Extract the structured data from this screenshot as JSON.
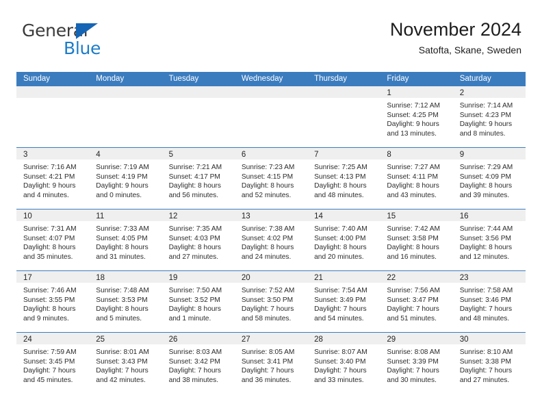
{
  "brand": {
    "name_top": "General",
    "name_bottom": "Blue",
    "accent_color": "#1d7cc9",
    "triangle_color": "#1565b4"
  },
  "header": {
    "title": "November 2024",
    "subtitle": "Satofta, Skane, Sweden",
    "header_bg": "#3b7cbf",
    "day_band_bg": "#efefef"
  },
  "weekdays": [
    "Sunday",
    "Monday",
    "Tuesday",
    "Wednesday",
    "Thursday",
    "Friday",
    "Saturday"
  ],
  "weeks": [
    [
      {
        "day": "",
        "empty": true,
        "sunrise": "",
        "sunset": "",
        "daylight_1": "",
        "daylight_2": ""
      },
      {
        "day": "",
        "empty": true,
        "sunrise": "",
        "sunset": "",
        "daylight_1": "",
        "daylight_2": ""
      },
      {
        "day": "",
        "empty": true,
        "sunrise": "",
        "sunset": "",
        "daylight_1": "",
        "daylight_2": ""
      },
      {
        "day": "",
        "empty": true,
        "sunrise": "",
        "sunset": "",
        "daylight_1": "",
        "daylight_2": ""
      },
      {
        "day": "",
        "empty": true,
        "sunrise": "",
        "sunset": "",
        "daylight_1": "",
        "daylight_2": ""
      },
      {
        "day": "1",
        "empty": false,
        "sunrise": "Sunrise: 7:12 AM",
        "sunset": "Sunset: 4:25 PM",
        "daylight_1": "Daylight: 9 hours",
        "daylight_2": "and 13 minutes."
      },
      {
        "day": "2",
        "empty": false,
        "sunrise": "Sunrise: 7:14 AM",
        "sunset": "Sunset: 4:23 PM",
        "daylight_1": "Daylight: 9 hours",
        "daylight_2": "and 8 minutes."
      }
    ],
    [
      {
        "day": "3",
        "empty": false,
        "sunrise": "Sunrise: 7:16 AM",
        "sunset": "Sunset: 4:21 PM",
        "daylight_1": "Daylight: 9 hours",
        "daylight_2": "and 4 minutes."
      },
      {
        "day": "4",
        "empty": false,
        "sunrise": "Sunrise: 7:19 AM",
        "sunset": "Sunset: 4:19 PM",
        "daylight_1": "Daylight: 9 hours",
        "daylight_2": "and 0 minutes."
      },
      {
        "day": "5",
        "empty": false,
        "sunrise": "Sunrise: 7:21 AM",
        "sunset": "Sunset: 4:17 PM",
        "daylight_1": "Daylight: 8 hours",
        "daylight_2": "and 56 minutes."
      },
      {
        "day": "6",
        "empty": false,
        "sunrise": "Sunrise: 7:23 AM",
        "sunset": "Sunset: 4:15 PM",
        "daylight_1": "Daylight: 8 hours",
        "daylight_2": "and 52 minutes."
      },
      {
        "day": "7",
        "empty": false,
        "sunrise": "Sunrise: 7:25 AM",
        "sunset": "Sunset: 4:13 PM",
        "daylight_1": "Daylight: 8 hours",
        "daylight_2": "and 48 minutes."
      },
      {
        "day": "8",
        "empty": false,
        "sunrise": "Sunrise: 7:27 AM",
        "sunset": "Sunset: 4:11 PM",
        "daylight_1": "Daylight: 8 hours",
        "daylight_2": "and 43 minutes."
      },
      {
        "day": "9",
        "empty": false,
        "sunrise": "Sunrise: 7:29 AM",
        "sunset": "Sunset: 4:09 PM",
        "daylight_1": "Daylight: 8 hours",
        "daylight_2": "and 39 minutes."
      }
    ],
    [
      {
        "day": "10",
        "empty": false,
        "sunrise": "Sunrise: 7:31 AM",
        "sunset": "Sunset: 4:07 PM",
        "daylight_1": "Daylight: 8 hours",
        "daylight_2": "and 35 minutes."
      },
      {
        "day": "11",
        "empty": false,
        "sunrise": "Sunrise: 7:33 AM",
        "sunset": "Sunset: 4:05 PM",
        "daylight_1": "Daylight: 8 hours",
        "daylight_2": "and 31 minutes."
      },
      {
        "day": "12",
        "empty": false,
        "sunrise": "Sunrise: 7:35 AM",
        "sunset": "Sunset: 4:03 PM",
        "daylight_1": "Daylight: 8 hours",
        "daylight_2": "and 27 minutes."
      },
      {
        "day": "13",
        "empty": false,
        "sunrise": "Sunrise: 7:38 AM",
        "sunset": "Sunset: 4:02 PM",
        "daylight_1": "Daylight: 8 hours",
        "daylight_2": "and 24 minutes."
      },
      {
        "day": "14",
        "empty": false,
        "sunrise": "Sunrise: 7:40 AM",
        "sunset": "Sunset: 4:00 PM",
        "daylight_1": "Daylight: 8 hours",
        "daylight_2": "and 20 minutes."
      },
      {
        "day": "15",
        "empty": false,
        "sunrise": "Sunrise: 7:42 AM",
        "sunset": "Sunset: 3:58 PM",
        "daylight_1": "Daylight: 8 hours",
        "daylight_2": "and 16 minutes."
      },
      {
        "day": "16",
        "empty": false,
        "sunrise": "Sunrise: 7:44 AM",
        "sunset": "Sunset: 3:56 PM",
        "daylight_1": "Daylight: 8 hours",
        "daylight_2": "and 12 minutes."
      }
    ],
    [
      {
        "day": "17",
        "empty": false,
        "sunrise": "Sunrise: 7:46 AM",
        "sunset": "Sunset: 3:55 PM",
        "daylight_1": "Daylight: 8 hours",
        "daylight_2": "and 9 minutes."
      },
      {
        "day": "18",
        "empty": false,
        "sunrise": "Sunrise: 7:48 AM",
        "sunset": "Sunset: 3:53 PM",
        "daylight_1": "Daylight: 8 hours",
        "daylight_2": "and 5 minutes."
      },
      {
        "day": "19",
        "empty": false,
        "sunrise": "Sunrise: 7:50 AM",
        "sunset": "Sunset: 3:52 PM",
        "daylight_1": "Daylight: 8 hours",
        "daylight_2": "and 1 minute."
      },
      {
        "day": "20",
        "empty": false,
        "sunrise": "Sunrise: 7:52 AM",
        "sunset": "Sunset: 3:50 PM",
        "daylight_1": "Daylight: 7 hours",
        "daylight_2": "and 58 minutes."
      },
      {
        "day": "21",
        "empty": false,
        "sunrise": "Sunrise: 7:54 AM",
        "sunset": "Sunset: 3:49 PM",
        "daylight_1": "Daylight: 7 hours",
        "daylight_2": "and 54 minutes."
      },
      {
        "day": "22",
        "empty": false,
        "sunrise": "Sunrise: 7:56 AM",
        "sunset": "Sunset: 3:47 PM",
        "daylight_1": "Daylight: 7 hours",
        "daylight_2": "and 51 minutes."
      },
      {
        "day": "23",
        "empty": false,
        "sunrise": "Sunrise: 7:58 AM",
        "sunset": "Sunset: 3:46 PM",
        "daylight_1": "Daylight: 7 hours",
        "daylight_2": "and 48 minutes."
      }
    ],
    [
      {
        "day": "24",
        "empty": false,
        "sunrise": "Sunrise: 7:59 AM",
        "sunset": "Sunset: 3:45 PM",
        "daylight_1": "Daylight: 7 hours",
        "daylight_2": "and 45 minutes."
      },
      {
        "day": "25",
        "empty": false,
        "sunrise": "Sunrise: 8:01 AM",
        "sunset": "Sunset: 3:43 PM",
        "daylight_1": "Daylight: 7 hours",
        "daylight_2": "and 42 minutes."
      },
      {
        "day": "26",
        "empty": false,
        "sunrise": "Sunrise: 8:03 AM",
        "sunset": "Sunset: 3:42 PM",
        "daylight_1": "Daylight: 7 hours",
        "daylight_2": "and 38 minutes."
      },
      {
        "day": "27",
        "empty": false,
        "sunrise": "Sunrise: 8:05 AM",
        "sunset": "Sunset: 3:41 PM",
        "daylight_1": "Daylight: 7 hours",
        "daylight_2": "and 36 minutes."
      },
      {
        "day": "28",
        "empty": false,
        "sunrise": "Sunrise: 8:07 AM",
        "sunset": "Sunset: 3:40 PM",
        "daylight_1": "Daylight: 7 hours",
        "daylight_2": "and 33 minutes."
      },
      {
        "day": "29",
        "empty": false,
        "sunrise": "Sunrise: 8:08 AM",
        "sunset": "Sunset: 3:39 PM",
        "daylight_1": "Daylight: 7 hours",
        "daylight_2": "and 30 minutes."
      },
      {
        "day": "30",
        "empty": false,
        "sunrise": "Sunrise: 8:10 AM",
        "sunset": "Sunset: 3:38 PM",
        "daylight_1": "Daylight: 7 hours",
        "daylight_2": "and 27 minutes."
      }
    ]
  ]
}
